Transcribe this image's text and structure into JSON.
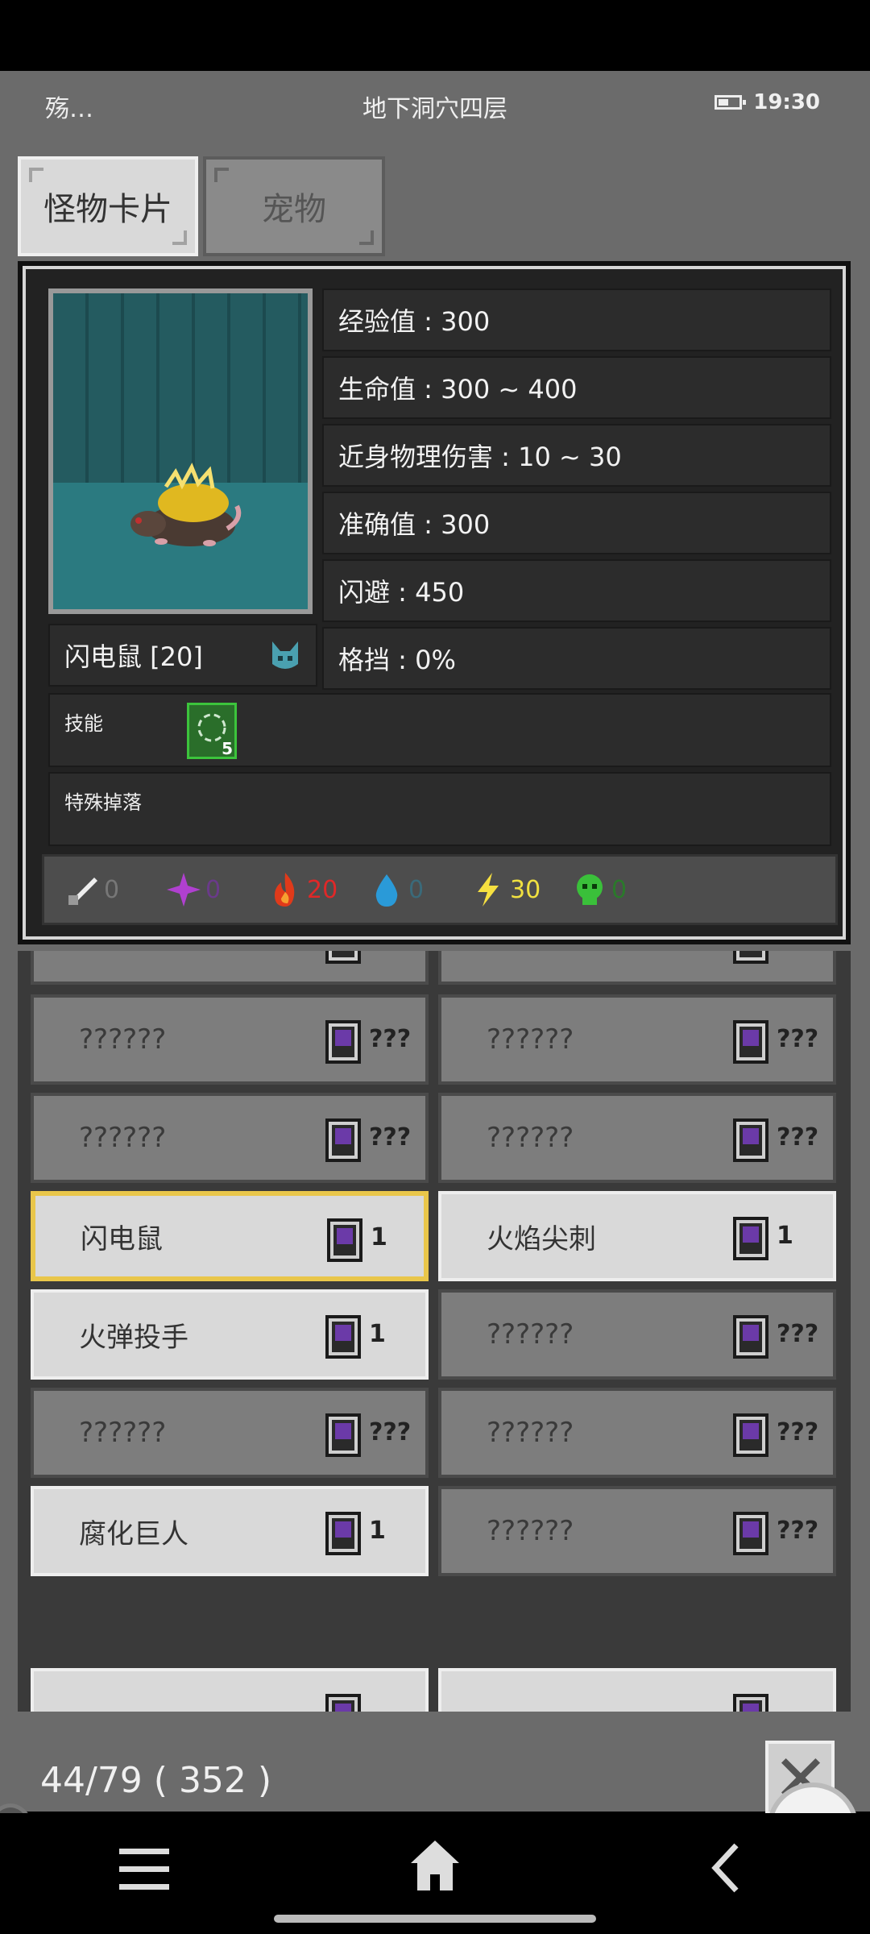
{
  "status_bar": {
    "carrier": "殇…",
    "title": "地下洞穴四层",
    "time": "19:30"
  },
  "tabs": [
    {
      "label": "怪物卡片",
      "active": true
    },
    {
      "label": "宠物",
      "active": false
    }
  ],
  "monster": {
    "name": "闪电鼠 [20]",
    "stats": [
      "经验值 : 300",
      "生命值 : 300 ~ 400",
      "近身物理伤害 : 10 ~ 30",
      "准确值 : 300",
      "闪避 : 450",
      "格挡 : 0%"
    ],
    "skills_label": "技能",
    "skill_level": "5",
    "drops_label": "特殊掉落",
    "resistances": [
      {
        "icon": "physical-icon",
        "value": "0",
        "color": "#777777"
      },
      {
        "icon": "arcane-icon",
        "value": "0",
        "color": "#6a3a8a"
      },
      {
        "icon": "fire-icon",
        "value": "20",
        "color": "#e02828"
      },
      {
        "icon": "water-icon",
        "value": "0",
        "color": "#3a6a7a"
      },
      {
        "icon": "lightning-icon",
        "value": "30",
        "color": "#f0e040"
      },
      {
        "icon": "poison-icon",
        "value": "0",
        "color": "#2a7a2a"
      }
    ]
  },
  "cards": [
    {
      "left": {
        "name": "??????",
        "count": "???",
        "known": false
      },
      "right": {
        "name": "??????",
        "count": "???",
        "known": false
      }
    },
    {
      "left": {
        "name": "??????",
        "count": "???",
        "known": false
      },
      "right": {
        "name": "??????",
        "count": "???",
        "known": false
      }
    },
    {
      "left": {
        "name": "闪电鼠",
        "count": "1",
        "known": true,
        "selected": true
      },
      "right": {
        "name": "火焰尖刺",
        "count": "1",
        "known": true
      }
    },
    {
      "left": {
        "name": "火弹投手",
        "count": "1",
        "known": true
      },
      "right": {
        "name": "??????",
        "count": "???",
        "known": false
      }
    },
    {
      "left": {
        "name": "??????",
        "count": "???",
        "known": false
      },
      "right": {
        "name": "??????",
        "count": "???",
        "known": false
      }
    },
    {
      "left": {
        "name": "腐化巨人",
        "count": "1",
        "known": true
      },
      "right": {
        "name": "??????",
        "count": "???",
        "known": false
      }
    }
  ],
  "footer": {
    "progress": "44/79 ( 352 )"
  },
  "colors": {
    "selected_border": "#e9c64a",
    "panel_bg": "#222222"
  }
}
